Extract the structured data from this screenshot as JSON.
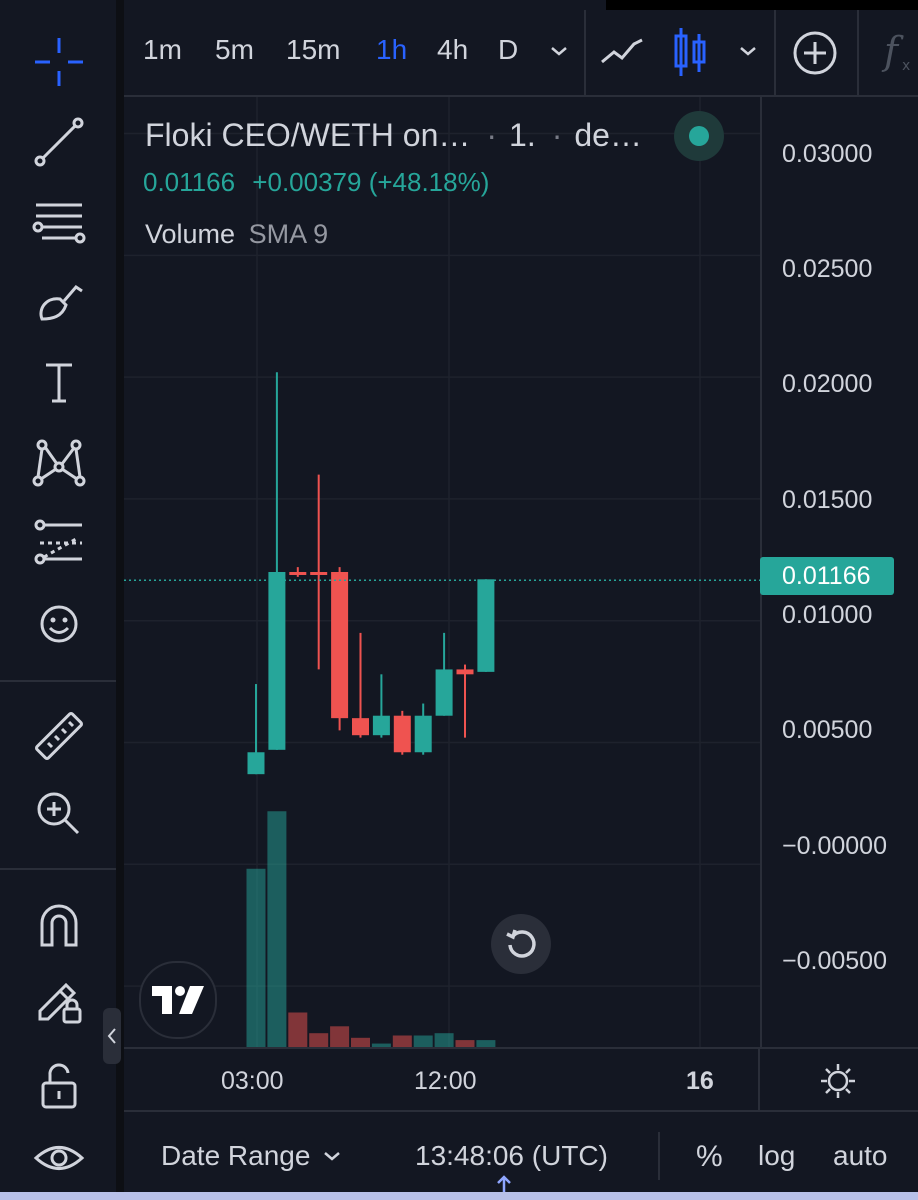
{
  "toolbar": {
    "timeframes": [
      "1m",
      "5m",
      "15m",
      "1h",
      "4h",
      "D"
    ],
    "active_timeframe": "1h"
  },
  "legend": {
    "symbol": "Floki CEO/WETH on…",
    "interval": "1.",
    "exchange": "de…",
    "last_price": "0.01166",
    "change": "+0.00379 (+48.18%)",
    "indicator_name": "Volume",
    "indicator_param": "SMA 9"
  },
  "price_axis": {
    "labels": [
      "0.03000",
      "0.02500",
      "0.02000",
      "0.01500",
      "0.01000",
      "0.00500",
      "−0.00000",
      "−0.00500"
    ],
    "current_price": "0.01166"
  },
  "time_axis": {
    "labels": [
      "03:00",
      "12:00",
      "16"
    ]
  },
  "bottom_bar": {
    "date_range": "Date Range",
    "clock": "13:48:06 (UTC)",
    "percent": "%",
    "log": "log",
    "auto": "auto"
  },
  "colors": {
    "up": "#26a69a",
    "down": "#ef5350",
    "active": "#2962ff",
    "background": "#131722"
  },
  "chart_data": {
    "type": "candlestick",
    "ylim": [
      -0.0075,
      0.0315
    ],
    "candles": [
      {
        "o": 0.0046,
        "h": 0.0074,
        "l": 0.0037,
        "c": 0.0046,
        "up": true,
        "o2": 0.0037
      },
      {
        "o": 0.0047,
        "h": 0.0202,
        "l": 0.0047,
        "c": 0.012,
        "up": true
      },
      {
        "o": 0.012,
        "h": 0.0122,
        "l": 0.0118,
        "c": 0.012,
        "up": false
      },
      {
        "o": 0.012,
        "h": 0.016,
        "l": 0.008,
        "c": 0.012,
        "up": false
      },
      {
        "o": 0.012,
        "h": 0.0122,
        "l": 0.0055,
        "c": 0.006,
        "up": false
      },
      {
        "o": 0.006,
        "h": 0.0095,
        "l": 0.0052,
        "c": 0.0053,
        "up": false
      },
      {
        "o": 0.0053,
        "h": 0.0078,
        "l": 0.0052,
        "c": 0.0061,
        "up": true
      },
      {
        "o": 0.0061,
        "h": 0.0063,
        "l": 0.0045,
        "c": 0.0046,
        "up": false
      },
      {
        "o": 0.0046,
        "h": 0.0066,
        "l": 0.0045,
        "c": 0.0061,
        "up": true
      },
      {
        "o": 0.0061,
        "h": 0.0095,
        "l": 0.0061,
        "c": 0.008,
        "up": true
      },
      {
        "o": 0.008,
        "h": 0.0082,
        "l": 0.0052,
        "c": 0.0078,
        "up": false
      },
      {
        "o": 0.0079,
        "h": 0.0117,
        "l": 0.0079,
        "c": 0.0117,
        "up": true
      }
    ],
    "volumes": [
      1.55,
      2.05,
      0.3,
      0.12,
      0.18,
      0.08,
      0.03,
      0.1,
      0.1,
      0.12,
      0.06,
      0.06
    ]
  }
}
